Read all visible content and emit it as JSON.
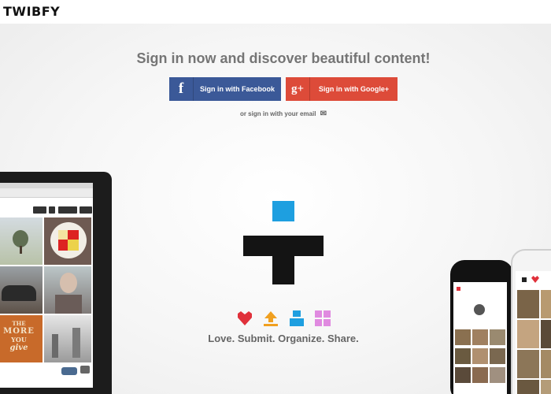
{
  "brand": {
    "logo_text": "TWIBFY"
  },
  "hero": {
    "headline": "Sign in now and discover beautiful content!"
  },
  "auth": {
    "facebook_label": "Sign in with Facebook",
    "google_label": "Sign in with Google+",
    "facebook_icon_text": "f",
    "google_icon_text": "g+",
    "email_link": "or sign in with your email"
  },
  "features": {
    "tagline": "Love. Submit. Organize. Share.",
    "icons": [
      "heart-icon",
      "upload-icon",
      "organize-icon",
      "share-grid-icon"
    ],
    "colors": {
      "love": "#e0313b",
      "submit": "#f0a020",
      "organize": "#1e9fe0",
      "share": "#e08ae0"
    }
  },
  "colors": {
    "facebook": "#3b5998",
    "google": "#dd4b39",
    "logo_square": "#1e9fe0",
    "logo_dark": "#141414",
    "text_gray": "#757575"
  },
  "laptop_screenshot": {
    "tiles": [
      "tree-photo",
      "mondrian-plate",
      "hedgehog-sculpture",
      "doll-portrait",
      "the-more-you-give-poster",
      "foggy-street"
    ],
    "tile_text": {
      "line1": "THE",
      "line2": "MORE",
      "line3": "YOU",
      "line4": "give"
    }
  }
}
